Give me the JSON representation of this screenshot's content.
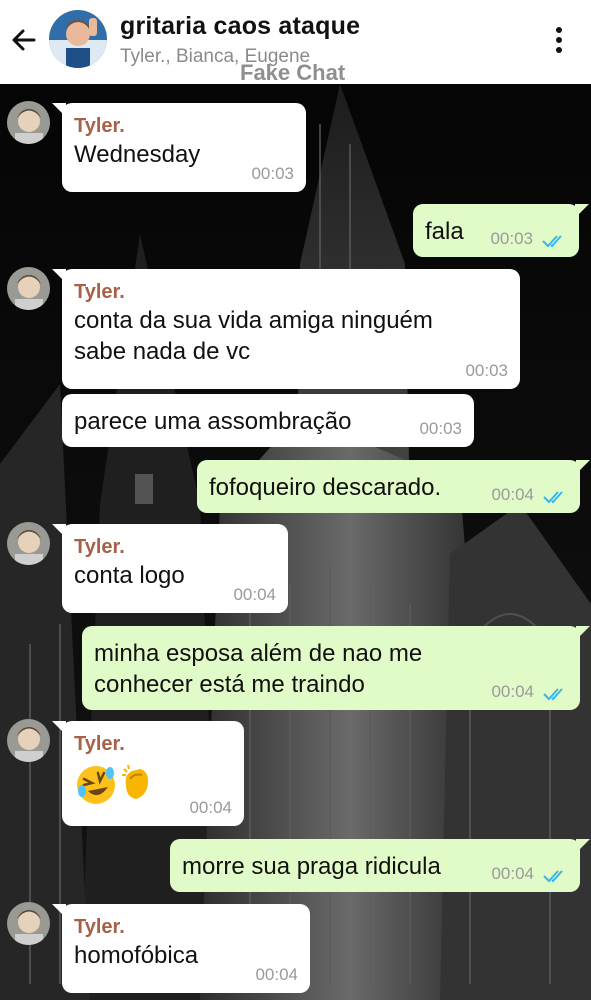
{
  "header": {
    "title": "gritaria caos ataque",
    "subtitle": "Tyler., Bianca, Eugene",
    "watermark": "Fake Chat"
  },
  "icons": {
    "back": "arrow-left-icon",
    "menu": "more-vertical-icon",
    "read_receipt": "double-check-icon",
    "emoji_laugh": "rolling-on-floor-laughing-emoji",
    "emoji_clap": "clapping-hands-emoji"
  },
  "colors": {
    "incoming_bubble": "#ffffff",
    "outgoing_bubble": "#e1fbc8",
    "sender_name": "#a66147",
    "read_tick": "#34b7f1",
    "timestamp": "#9a9a9a"
  },
  "messages": [
    {
      "dir": "in",
      "sender": "Tyler.",
      "text": "Wednesday",
      "time": "00:03"
    },
    {
      "dir": "out",
      "text": "fala",
      "time": "00:03"
    },
    {
      "dir": "in",
      "sender": "Tyler.",
      "text": "conta da sua vida amiga ninguém\nsabe nada de vc",
      "time": "00:03"
    },
    {
      "dir": "in",
      "text": "parece uma assombração",
      "time": "00:03"
    },
    {
      "dir": "out",
      "text": "fofoqueiro descarado.",
      "time": "00:04"
    },
    {
      "dir": "in",
      "sender": "Tyler.",
      "text": "conta logo",
      "time": "00:04"
    },
    {
      "dir": "out",
      "text": "minha esposa além de nao me\nconhecer está me traindo",
      "time": "00:04"
    },
    {
      "dir": "in",
      "sender": "Tyler.",
      "text": "",
      "time": "00:04"
    },
    {
      "dir": "out",
      "text": "morre sua praga ridicula",
      "time": "00:04"
    },
    {
      "dir": "in",
      "sender": "Tyler.",
      "text": "homofóbica",
      "time": "00:04"
    }
  ]
}
